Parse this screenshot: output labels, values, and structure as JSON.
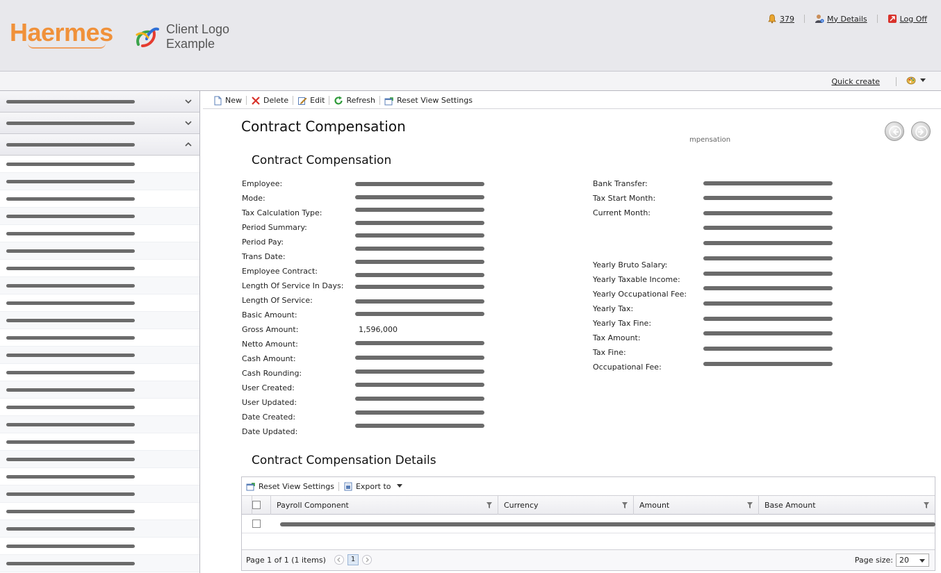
{
  "header": {
    "logo_text": "Haermes",
    "client_logo_line1": "Client Logo",
    "client_logo_line2": "Example",
    "notifications_count": "379",
    "my_details": "My Details",
    "log_off": "Log Off"
  },
  "subbar": {
    "quick_create": "Quick create"
  },
  "toolbar": {
    "new": "New",
    "delete": "Delete",
    "edit": "Edit",
    "refresh": "Refresh",
    "reset_view": "Reset View Settings"
  },
  "main": {
    "page_title": "Contract Compensation",
    "subcaption": "mpensation",
    "section_title": "Contract Compensation",
    "left_fields": [
      {
        "label": "Employee:"
      },
      {
        "label": "Mode:"
      },
      {
        "label": "Tax Calculation Type:"
      },
      {
        "label": "Period Summary:"
      },
      {
        "label": "Period Pay:"
      },
      {
        "label": "Trans Date:"
      },
      {
        "label": "Employee Contract:"
      },
      {
        "label": "Length Of Service In Days:"
      },
      {
        "label": "Length Of Service:"
      },
      {
        "label": "Basic Amount:"
      },
      {
        "label": "Gross Amount:",
        "value": "1,596,000"
      },
      {
        "label": "Netto Amount:"
      },
      {
        "label": "Cash Amount:"
      },
      {
        "label": "Cash Rounding:"
      },
      {
        "label": "User Created:"
      },
      {
        "label": "User Updated:"
      },
      {
        "label": "Date Created:"
      },
      {
        "label": "Date Updated:"
      }
    ],
    "right_fields": [
      {
        "label": "Bank Transfer:"
      },
      {
        "label": "Tax Start Month:"
      },
      {
        "label": "Current Month:"
      },
      {
        "label": ""
      },
      {
        "label": ""
      },
      {
        "label": ""
      },
      {
        "label": "Yearly Bruto Salary:"
      },
      {
        "label": "Yearly Taxable Income:"
      },
      {
        "label": "Yearly Occupational Fee:"
      },
      {
        "label": "Yearly Tax:"
      },
      {
        "label": "Yearly Tax Fine:"
      },
      {
        "label": "Tax Amount:"
      },
      {
        "label": "Tax Fine:"
      },
      {
        "label": "Occupational Fee:"
      }
    ],
    "details_title": "Contract Compensation Details"
  },
  "grid": {
    "reset_view": "Reset View Settings",
    "export_to": "Export to",
    "columns": [
      "Payroll Component",
      "Currency",
      "Amount",
      "Base Amount"
    ],
    "pager_text": "Page 1 of 1 (1 items)",
    "current_page": "1",
    "page_size_label": "Page size:",
    "page_size": "20"
  }
}
